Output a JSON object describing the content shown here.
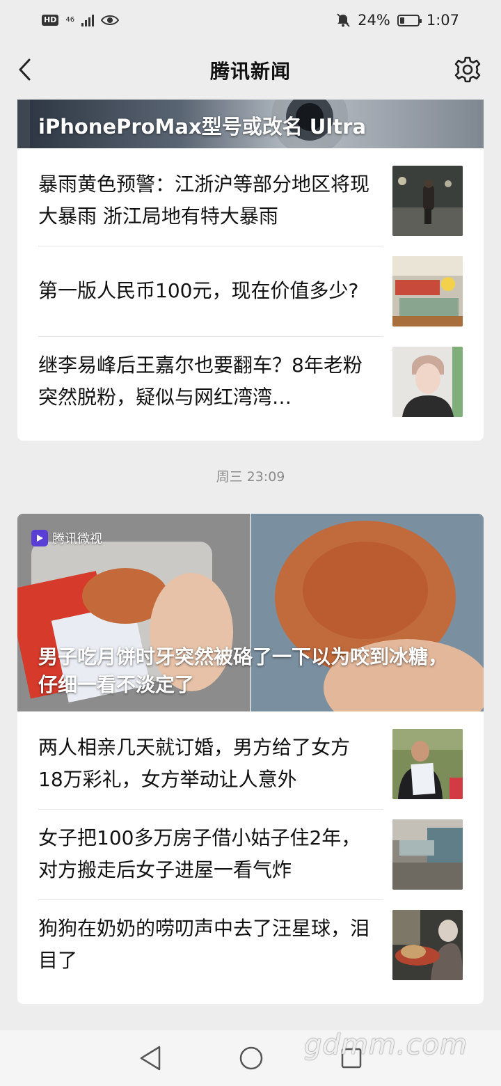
{
  "status_bar": {
    "hd_label": "HD",
    "network_label": "46",
    "battery_percent": "24%",
    "battery_level": 0.24,
    "time": "1:07"
  },
  "header": {
    "title": "腾讯新闻"
  },
  "feed": {
    "group1": {
      "hero_caption": "iPhoneProMax型号或改名 Ultra",
      "items": [
        {
          "title": "暴雨黄色预警：江浙沪等部分地区将现大暴雨 浙江局地有特大暴雨"
        },
        {
          "title": "第一版人民币100元，现在价值多少?"
        },
        {
          "title": "继李易峰后王嘉尔也要翻车？8年老粉突然脱粉，疑似与网红湾湾…"
        }
      ]
    },
    "timestamp": "周三 23:09",
    "group2": {
      "video_badge": "腾讯微视",
      "hero_caption": "男子吃月饼时牙突然被硌了一下以为咬到冰糖，仔细一看不淡定了",
      "items": [
        {
          "title": "两人相亲几天就订婚，男方给了女方18万彩礼，女方举动让人意外"
        },
        {
          "title": "女子把100多万房子借小姑子住2年，对方搬走后女子进屋一看气炸"
        },
        {
          "title": "狗狗在奶奶的唠叨声中去了汪星球，泪目了"
        }
      ]
    }
  },
  "watermark": "gdmm.com",
  "icons": {
    "back": "back-arrow-icon",
    "settings": "gear-icon",
    "mute": "bell-off-icon",
    "eye": "eye-icon",
    "nav_back": "triangle-back-icon",
    "nav_home": "circle-home-icon",
    "nav_recent": "square-recent-icon"
  },
  "colors": {
    "background": "#ededed",
    "card": "#ffffff",
    "timestamp": "#8c8c8c",
    "video_logo": "#5a3fd6"
  }
}
